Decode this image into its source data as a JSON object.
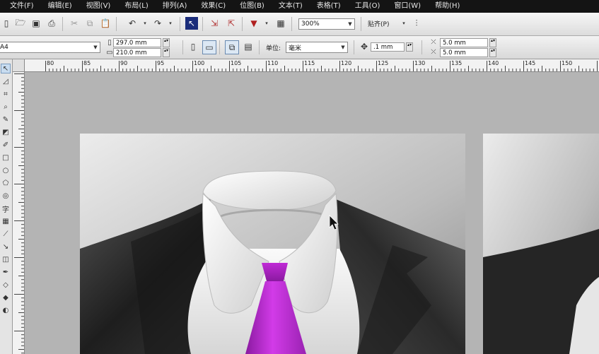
{
  "menu": {
    "items": [
      "文件(F)",
      "编辑(E)",
      "视图(V)",
      "布局(L)",
      "排列(A)",
      "效果(C)",
      "位图(B)",
      "文本(T)",
      "表格(T)",
      "工具(O)",
      "窗口(W)",
      "帮助(H)"
    ]
  },
  "toolbar": {
    "zoom_value": "300%",
    "snap_label": "贴齐(P)",
    "page_size": "A4",
    "width_value": "297.0 mm",
    "height_value": "210.0 mm",
    "units_label": "单位:",
    "units_value": "毫米",
    "nudge_value": ".1 mm",
    "dup_x_value": "5.0 mm",
    "dup_y_value": "5.0 mm"
  },
  "ruler": {
    "ticks": [
      "80",
      "85",
      "90",
      "95",
      "100",
      "105",
      "110",
      "115",
      "120",
      "125",
      "130",
      "135",
      "140",
      "145",
      "150"
    ]
  },
  "colors": {
    "tie": "#b21fc9",
    "shirt": "#f0f0f0",
    "jacket": "#2a2a2a",
    "menubar": "#141414"
  },
  "icons": {
    "pointer": "pick-tool-icon",
    "cursor": "mouse-cursor-icon"
  }
}
